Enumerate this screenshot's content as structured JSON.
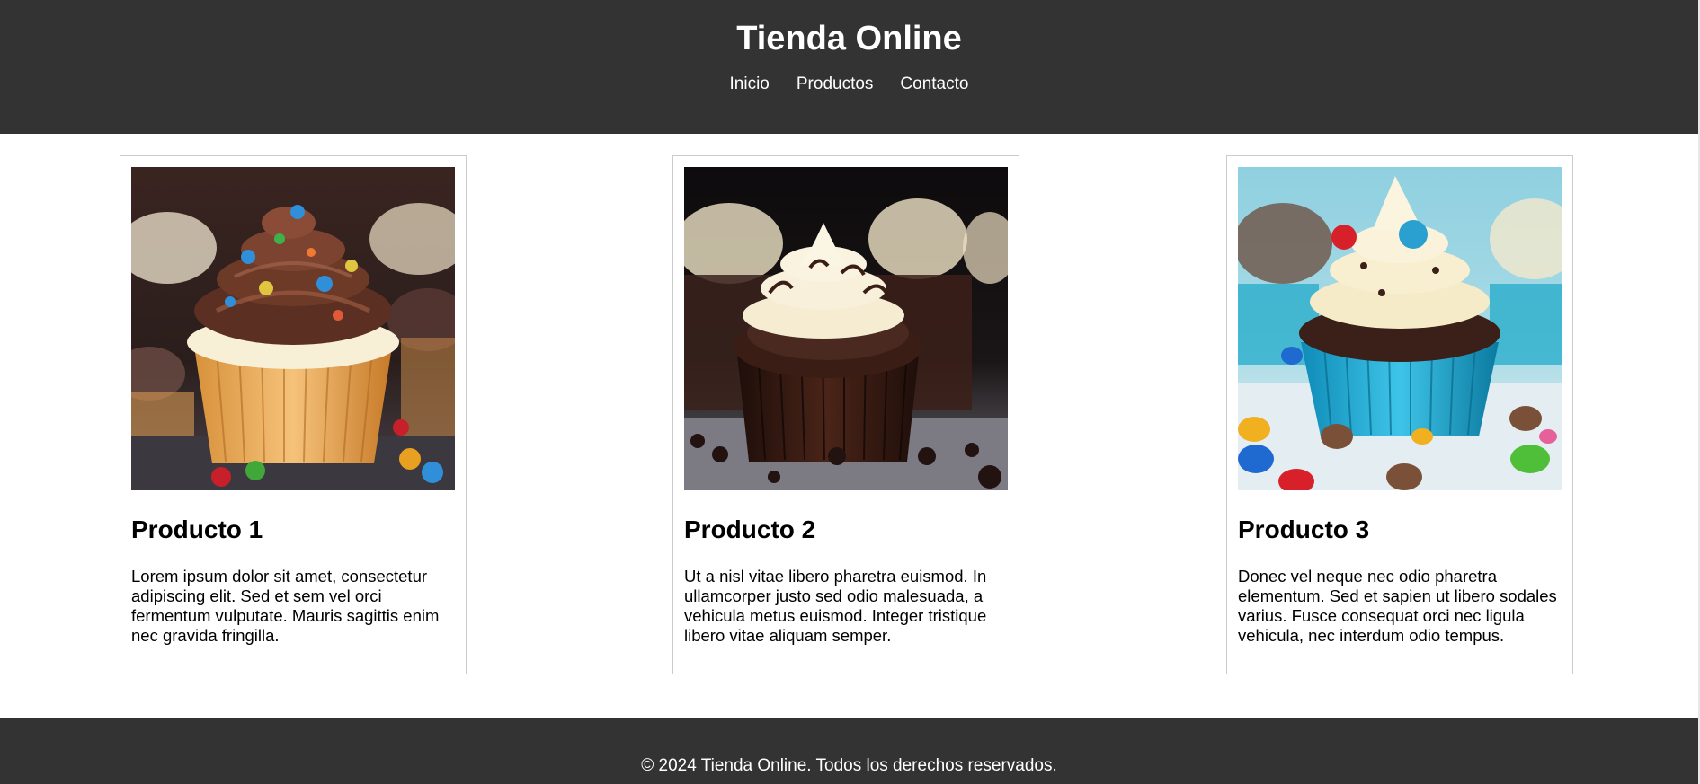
{
  "header": {
    "title": "Tienda Online",
    "nav": [
      {
        "label": "Inicio"
      },
      {
        "label": "Productos"
      },
      {
        "label": "Contacto"
      }
    ]
  },
  "products": [
    {
      "title": "Producto 1",
      "description": "Lorem ipsum dolor sit amet, consectetur adipiscing elit. Sed et sem vel orci fermentum vulputate. Mauris sagittis enim nec gravida fringilla.",
      "image_icon": "cupcake-chocolate-frosting-sprinkles-image"
    },
    {
      "title": "Producto 2",
      "description": "Ut a nisl vitae libero pharetra euismod. In ullamcorper justo sed odio malesuada, a vehicula metus euismod. Integer tristique libero vitae aliquam semper.",
      "image_icon": "cupcake-chocolate-cream-frosting-image"
    },
    {
      "title": "Producto 3",
      "description": "Donec vel neque nec odio pharetra elementum. Sed et sapien ut libero sodales varius. Fusce consequat orci nec ligula vehicula, nec interdum odio tempus.",
      "image_icon": "cupcake-blue-wrapper-candies-image"
    }
  ],
  "footer": {
    "text": "© 2024 Tienda Online. Todos los derechos reservados."
  },
  "colors": {
    "header_bg": "#333333",
    "footer_bg": "#333333",
    "card_border": "#cccccc",
    "text": "#000000",
    "header_text": "#ffffff"
  }
}
